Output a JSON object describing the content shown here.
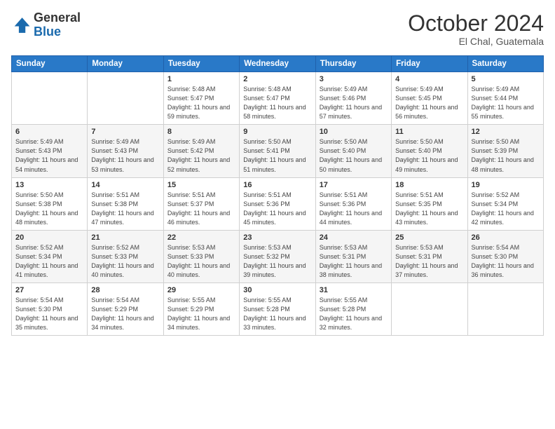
{
  "logo": {
    "general": "General",
    "blue": "Blue"
  },
  "header": {
    "month": "October 2024",
    "location": "El Chal, Guatemala"
  },
  "weekdays": [
    "Sunday",
    "Monday",
    "Tuesday",
    "Wednesday",
    "Thursday",
    "Friday",
    "Saturday"
  ],
  "weeks": [
    [
      {
        "day": "",
        "sunrise": "",
        "sunset": "",
        "daylight": ""
      },
      {
        "day": "",
        "sunrise": "",
        "sunset": "",
        "daylight": ""
      },
      {
        "day": "1",
        "sunrise": "Sunrise: 5:48 AM",
        "sunset": "Sunset: 5:47 PM",
        "daylight": "Daylight: 11 hours and 59 minutes."
      },
      {
        "day": "2",
        "sunrise": "Sunrise: 5:48 AM",
        "sunset": "Sunset: 5:47 PM",
        "daylight": "Daylight: 11 hours and 58 minutes."
      },
      {
        "day": "3",
        "sunrise": "Sunrise: 5:49 AM",
        "sunset": "Sunset: 5:46 PM",
        "daylight": "Daylight: 11 hours and 57 minutes."
      },
      {
        "day": "4",
        "sunrise": "Sunrise: 5:49 AM",
        "sunset": "Sunset: 5:45 PM",
        "daylight": "Daylight: 11 hours and 56 minutes."
      },
      {
        "day": "5",
        "sunrise": "Sunrise: 5:49 AM",
        "sunset": "Sunset: 5:44 PM",
        "daylight": "Daylight: 11 hours and 55 minutes."
      }
    ],
    [
      {
        "day": "6",
        "sunrise": "Sunrise: 5:49 AM",
        "sunset": "Sunset: 5:43 PM",
        "daylight": "Daylight: 11 hours and 54 minutes."
      },
      {
        "day": "7",
        "sunrise": "Sunrise: 5:49 AM",
        "sunset": "Sunset: 5:43 PM",
        "daylight": "Daylight: 11 hours and 53 minutes."
      },
      {
        "day": "8",
        "sunrise": "Sunrise: 5:49 AM",
        "sunset": "Sunset: 5:42 PM",
        "daylight": "Daylight: 11 hours and 52 minutes."
      },
      {
        "day": "9",
        "sunrise": "Sunrise: 5:50 AM",
        "sunset": "Sunset: 5:41 PM",
        "daylight": "Daylight: 11 hours and 51 minutes."
      },
      {
        "day": "10",
        "sunrise": "Sunrise: 5:50 AM",
        "sunset": "Sunset: 5:40 PM",
        "daylight": "Daylight: 11 hours and 50 minutes."
      },
      {
        "day": "11",
        "sunrise": "Sunrise: 5:50 AM",
        "sunset": "Sunset: 5:40 PM",
        "daylight": "Daylight: 11 hours and 49 minutes."
      },
      {
        "day": "12",
        "sunrise": "Sunrise: 5:50 AM",
        "sunset": "Sunset: 5:39 PM",
        "daylight": "Daylight: 11 hours and 48 minutes."
      }
    ],
    [
      {
        "day": "13",
        "sunrise": "Sunrise: 5:50 AM",
        "sunset": "Sunset: 5:38 PM",
        "daylight": "Daylight: 11 hours and 48 minutes."
      },
      {
        "day": "14",
        "sunrise": "Sunrise: 5:51 AM",
        "sunset": "Sunset: 5:38 PM",
        "daylight": "Daylight: 11 hours and 47 minutes."
      },
      {
        "day": "15",
        "sunrise": "Sunrise: 5:51 AM",
        "sunset": "Sunset: 5:37 PM",
        "daylight": "Daylight: 11 hours and 46 minutes."
      },
      {
        "day": "16",
        "sunrise": "Sunrise: 5:51 AM",
        "sunset": "Sunset: 5:36 PM",
        "daylight": "Daylight: 11 hours and 45 minutes."
      },
      {
        "day": "17",
        "sunrise": "Sunrise: 5:51 AM",
        "sunset": "Sunset: 5:36 PM",
        "daylight": "Daylight: 11 hours and 44 minutes."
      },
      {
        "day": "18",
        "sunrise": "Sunrise: 5:51 AM",
        "sunset": "Sunset: 5:35 PM",
        "daylight": "Daylight: 11 hours and 43 minutes."
      },
      {
        "day": "19",
        "sunrise": "Sunrise: 5:52 AM",
        "sunset": "Sunset: 5:34 PM",
        "daylight": "Daylight: 11 hours and 42 minutes."
      }
    ],
    [
      {
        "day": "20",
        "sunrise": "Sunrise: 5:52 AM",
        "sunset": "Sunset: 5:34 PM",
        "daylight": "Daylight: 11 hours and 41 minutes."
      },
      {
        "day": "21",
        "sunrise": "Sunrise: 5:52 AM",
        "sunset": "Sunset: 5:33 PM",
        "daylight": "Daylight: 11 hours and 40 minutes."
      },
      {
        "day": "22",
        "sunrise": "Sunrise: 5:53 AM",
        "sunset": "Sunset: 5:33 PM",
        "daylight": "Daylight: 11 hours and 40 minutes."
      },
      {
        "day": "23",
        "sunrise": "Sunrise: 5:53 AM",
        "sunset": "Sunset: 5:32 PM",
        "daylight": "Daylight: 11 hours and 39 minutes."
      },
      {
        "day": "24",
        "sunrise": "Sunrise: 5:53 AM",
        "sunset": "Sunset: 5:31 PM",
        "daylight": "Daylight: 11 hours and 38 minutes."
      },
      {
        "day": "25",
        "sunrise": "Sunrise: 5:53 AM",
        "sunset": "Sunset: 5:31 PM",
        "daylight": "Daylight: 11 hours and 37 minutes."
      },
      {
        "day": "26",
        "sunrise": "Sunrise: 5:54 AM",
        "sunset": "Sunset: 5:30 PM",
        "daylight": "Daylight: 11 hours and 36 minutes."
      }
    ],
    [
      {
        "day": "27",
        "sunrise": "Sunrise: 5:54 AM",
        "sunset": "Sunset: 5:30 PM",
        "daylight": "Daylight: 11 hours and 35 minutes."
      },
      {
        "day": "28",
        "sunrise": "Sunrise: 5:54 AM",
        "sunset": "Sunset: 5:29 PM",
        "daylight": "Daylight: 11 hours and 34 minutes."
      },
      {
        "day": "29",
        "sunrise": "Sunrise: 5:55 AM",
        "sunset": "Sunset: 5:29 PM",
        "daylight": "Daylight: 11 hours and 34 minutes."
      },
      {
        "day": "30",
        "sunrise": "Sunrise: 5:55 AM",
        "sunset": "Sunset: 5:28 PM",
        "daylight": "Daylight: 11 hours and 33 minutes."
      },
      {
        "day": "31",
        "sunrise": "Sunrise: 5:55 AM",
        "sunset": "Sunset: 5:28 PM",
        "daylight": "Daylight: 11 hours and 32 minutes."
      },
      {
        "day": "",
        "sunrise": "",
        "sunset": "",
        "daylight": ""
      },
      {
        "day": "",
        "sunrise": "",
        "sunset": "",
        "daylight": ""
      }
    ]
  ]
}
